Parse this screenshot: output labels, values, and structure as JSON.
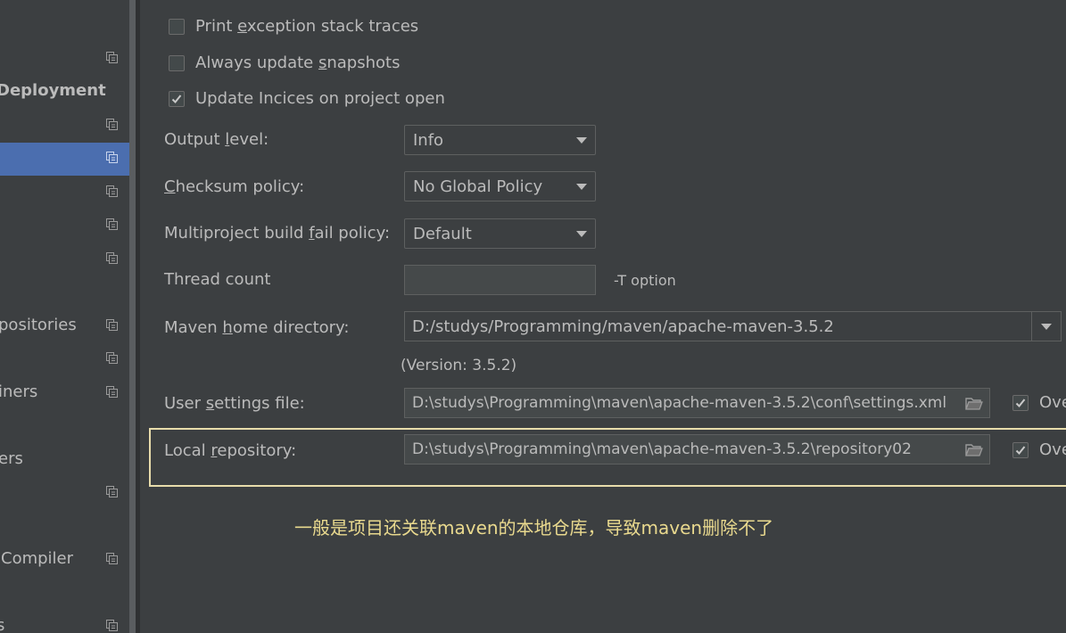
{
  "sidebar": {
    "items": [
      {
        "label": ""
      },
      {
        "label": "Deployment"
      },
      {
        "label": ""
      },
      {
        "label": ""
      },
      {
        "label": ""
      },
      {
        "label": ""
      },
      {
        "label": ""
      },
      {
        "label": "positories"
      },
      {
        "label": ""
      },
      {
        "label": "iners"
      },
      {
        "label": "ers"
      },
      {
        "label": ""
      },
      {
        "label": "Compiler"
      },
      {
        "label": "s"
      }
    ]
  },
  "options": {
    "print_stack_traces": {
      "pre": "Print ",
      "u": "e",
      "post": "xception stack traces",
      "checked": false
    },
    "update_snapshots": {
      "pre": "Always update ",
      "u": "s",
      "post": "napshots",
      "checked": false
    },
    "update_indices": {
      "label": "Update Incices on project open",
      "checked": true
    }
  },
  "output_level": {
    "pre": "Output ",
    "u": "l",
    "post": "evel:",
    "value": "Info"
  },
  "checksum_policy": {
    "pre": "",
    "u": "C",
    "post": "hecksum policy:",
    "value": "No Global Policy"
  },
  "fail_policy": {
    "pre": "Multiproject build ",
    "u": "f",
    "post": "ail policy:",
    "value": "Default"
  },
  "thread_count": {
    "label": "Thread count",
    "value": "",
    "hint": "-T option"
  },
  "maven_home": {
    "pre": "Maven ",
    "u": "h",
    "post": "ome directory:",
    "value": "D:/studys/Programming/maven/apache-maven-3.5.2",
    "version": "(Version: 3.5.2)"
  },
  "user_settings": {
    "pre": "User ",
    "u": "s",
    "post": "ettings file:",
    "value": "D:\\studys\\Programming\\maven\\apache-maven-3.5.2\\conf\\settings.xml",
    "override_label": "Ove"
  },
  "local_repo": {
    "pre": "Local ",
    "u": "r",
    "post": "epository:",
    "value": "D:\\studys\\Programming\\maven\\apache-maven-3.5.2\\repository02",
    "override_label": "Ove"
  },
  "note": "一般是项目还关联maven的本地仓库，导致maven删除不了",
  "colors": {
    "background": "#3c3f41",
    "selection": "#4b6eaf",
    "note": "#e9d98e",
    "highlight_border": "#e8dcab"
  }
}
